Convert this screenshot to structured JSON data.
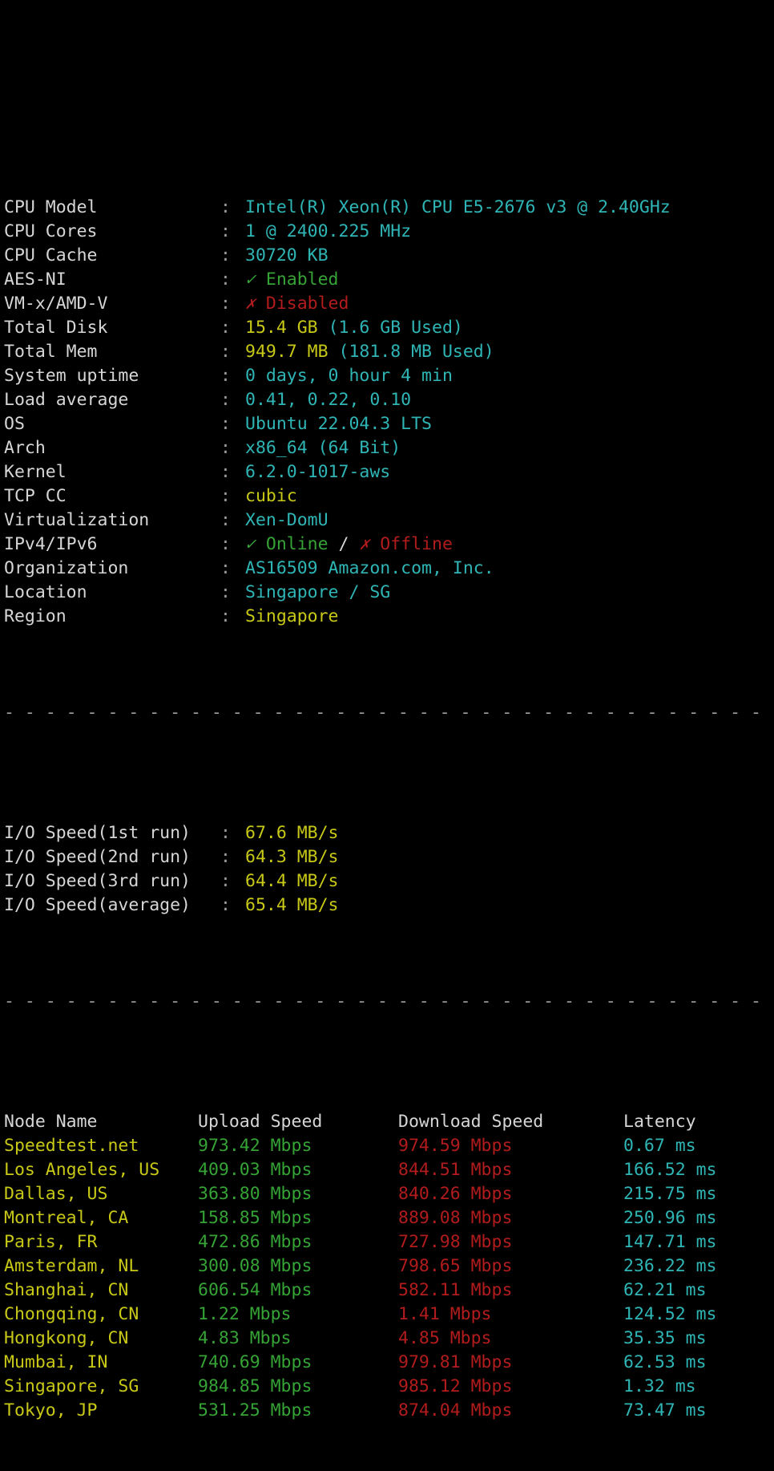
{
  "terminal": {
    "separator_char": "-",
    "separator_width": 64,
    "colon": ":",
    "check_glyph": "✓",
    "cross_glyph": "✗"
  },
  "colors": {
    "background": "#000000",
    "label": "#d6d6d6",
    "cyan": "#2fb5b5",
    "yellow": "#c8c817",
    "green": "#35a335",
    "red": "#b21c1c",
    "grey": "#9a9a9a"
  },
  "sysinfo": {
    "rows": [
      {
        "label": "CPU Model",
        "value": "Intel(R) Xeon(R) CPU E5-2676 v3 @ 2.40GHz"
      },
      {
        "label": "CPU Cores",
        "value": "1 @ 2400.225 MHz"
      },
      {
        "label": "CPU Cache",
        "value": "30720 KB"
      },
      {
        "label": "AES-NI",
        "value": "Enabled"
      },
      {
        "label": "VM-x/AMD-V",
        "value": "Disabled"
      },
      {
        "label": "Total Disk",
        "value": "15.4 GB",
        "extra": "(1.6 GB Used)"
      },
      {
        "label": "Total Mem",
        "value": "949.7 MB",
        "extra": "(181.8 MB Used)"
      },
      {
        "label": "System uptime",
        "value": "0 days, 0 hour 4 min"
      },
      {
        "label": "Load average",
        "value": "0.41, 0.22, 0.10"
      },
      {
        "label": "OS",
        "value": "Ubuntu 22.04.3 LTS"
      },
      {
        "label": "Arch",
        "value": "x86_64 (64 Bit)"
      },
      {
        "label": "Kernel",
        "value": "6.2.0-1017-aws"
      },
      {
        "label": "TCP CC",
        "value": "cubic"
      },
      {
        "label": "Virtualization",
        "value": "Xen-DomU"
      },
      {
        "label": "IPv4/IPv6",
        "value": "Online",
        "value2": "Offline",
        "divider": "/"
      },
      {
        "label": "Organization",
        "value": "AS16509 Amazon.com, Inc."
      },
      {
        "label": "Location",
        "value": "Singapore / SG"
      },
      {
        "label": "Region",
        "value": "Singapore"
      }
    ]
  },
  "iospeed": {
    "rows": [
      {
        "label": "I/O Speed(1st run)",
        "value": "67.6 MB/s"
      },
      {
        "label": "I/O Speed(2nd run)",
        "value": "64.3 MB/s"
      },
      {
        "label": "I/O Speed(3rd run)",
        "value": "64.4 MB/s"
      },
      {
        "label": "I/O Speed(average)",
        "value": "65.4 MB/s"
      }
    ]
  },
  "speedtest": {
    "headers": {
      "node": "Node Name",
      "upload": "Upload Speed",
      "download": "Download Speed",
      "latency": "Latency"
    },
    "rows": [
      {
        "node": "Speedtest.net",
        "upload": "973.42 Mbps",
        "download": "974.59 Mbps",
        "latency": "0.67 ms"
      },
      {
        "node": "Los Angeles, US",
        "upload": "409.03 Mbps",
        "download": "844.51 Mbps",
        "latency": "166.52 ms"
      },
      {
        "node": "Dallas, US",
        "upload": "363.80 Mbps",
        "download": "840.26 Mbps",
        "latency": "215.75 ms"
      },
      {
        "node": "Montreal, CA",
        "upload": "158.85 Mbps",
        "download": "889.08 Mbps",
        "latency": "250.96 ms"
      },
      {
        "node": "Paris, FR",
        "upload": "472.86 Mbps",
        "download": "727.98 Mbps",
        "latency": "147.71 ms"
      },
      {
        "node": "Amsterdam, NL",
        "upload": "300.08 Mbps",
        "download": "798.65 Mbps",
        "latency": "236.22 ms"
      },
      {
        "node": "Shanghai, CN",
        "upload": "606.54 Mbps",
        "download": "582.11 Mbps",
        "latency": "62.21 ms"
      },
      {
        "node": "Chongqing, CN",
        "upload": "1.22 Mbps",
        "download": "1.41 Mbps",
        "latency": "124.52 ms"
      },
      {
        "node": "Hongkong, CN",
        "upload": "4.83 Mbps",
        "download": "4.85 Mbps",
        "latency": "35.35 ms"
      },
      {
        "node": "Mumbai, IN",
        "upload": "740.69 Mbps",
        "download": "979.81 Mbps",
        "latency": "62.53 ms"
      },
      {
        "node": "Singapore, SG",
        "upload": "984.85 Mbps",
        "download": "985.12 Mbps",
        "latency": "1.32 ms"
      },
      {
        "node": "Tokyo, JP",
        "upload": "531.25 Mbps",
        "download": "874.04 Mbps",
        "latency": "73.47 ms"
      }
    ]
  }
}
